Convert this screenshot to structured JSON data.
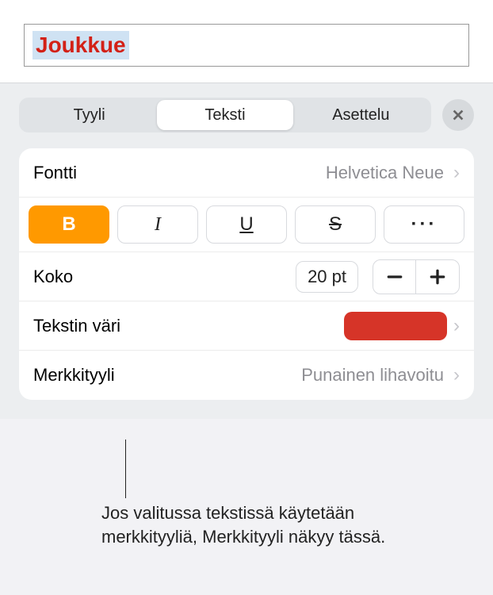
{
  "canvas": {
    "selected_text": "Joukkue"
  },
  "tabs": {
    "style": "Tyyli",
    "text": "Teksti",
    "layout": "Asettelu"
  },
  "font": {
    "label": "Fontti",
    "value": "Helvetica Neue"
  },
  "style_buttons": {
    "bold": "B",
    "italic": "I",
    "underline": "U",
    "strike": "S",
    "more": "···"
  },
  "size": {
    "label": "Koko",
    "value": "20 pt"
  },
  "text_color": {
    "label": "Tekstin väri",
    "color": "#d63428"
  },
  "char_style": {
    "label": "Merkkityyli",
    "value": "Punainen lihavoitu"
  },
  "callout": "Jos valitussa tekstissä käytetään merkkityyliä, Merkkityyli näkyy tässä."
}
